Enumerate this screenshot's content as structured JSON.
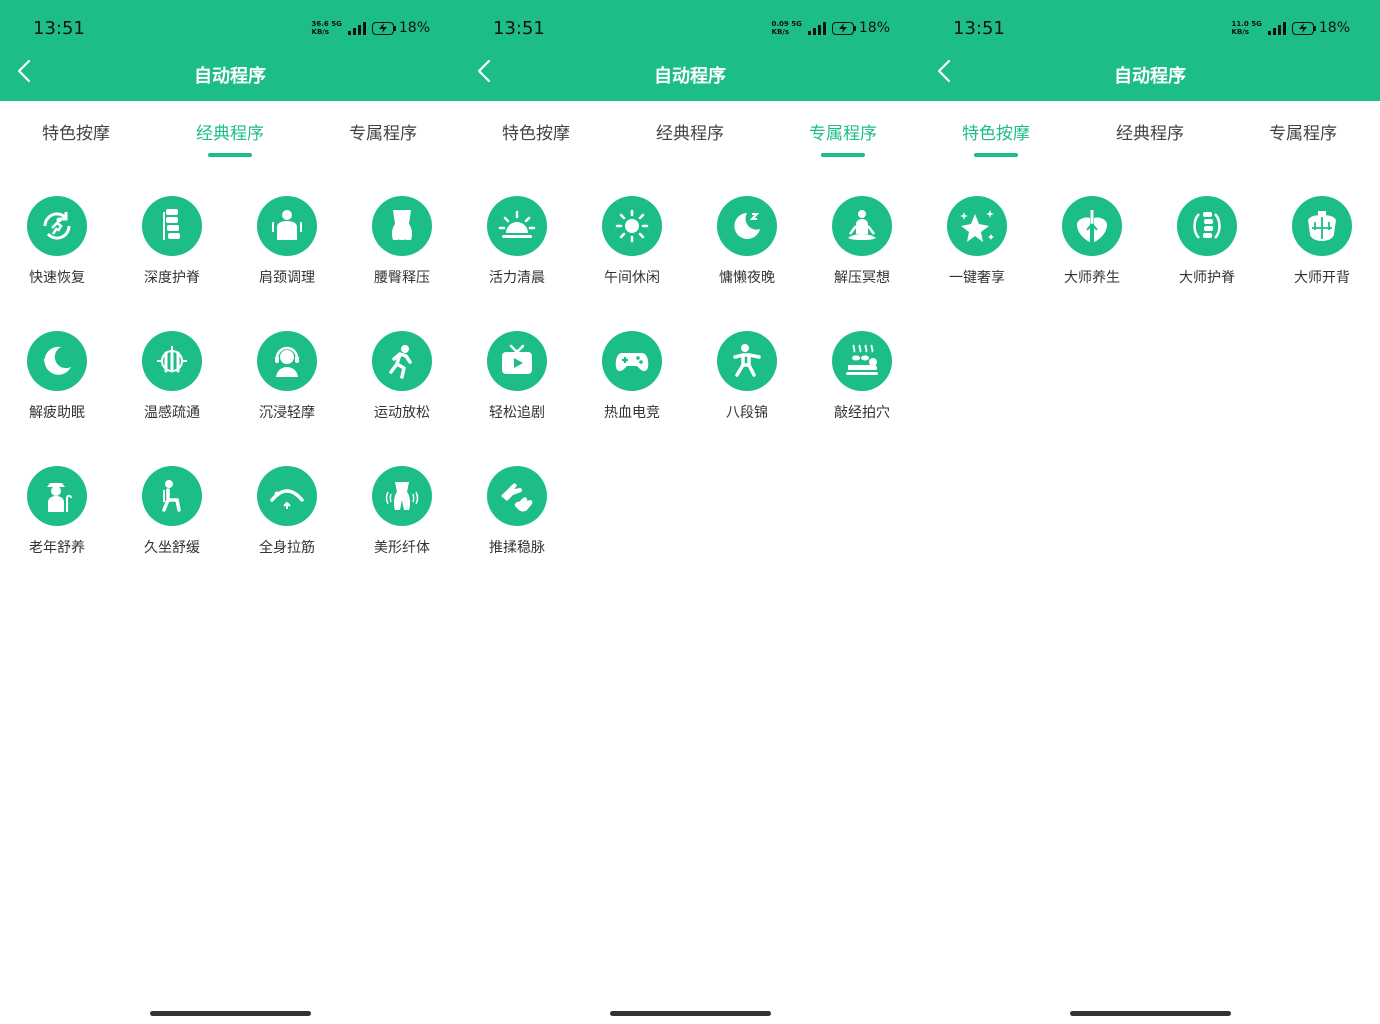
{
  "colors": {
    "accent": "#1dbd88",
    "text": "#333333"
  },
  "screens": [
    {
      "status": {
        "time": "13:51",
        "speed_top": "36.6",
        "speed_unit": "KB/s",
        "network": "5G",
        "battery": "18%"
      },
      "title": "自动程序",
      "tabs": [
        {
          "label": "特色按摩",
          "active": false
        },
        {
          "label": "经典程序",
          "active": true
        },
        {
          "label": "专属程序",
          "active": false
        }
      ],
      "items": [
        {
          "label": "快速恢复",
          "icon": "quick-recovery-icon"
        },
        {
          "label": "深度护脊",
          "icon": "spine-icon"
        },
        {
          "label": "肩颈调理",
          "icon": "shoulder-neck-icon"
        },
        {
          "label": "腰臀释压",
          "icon": "waist-hip-icon"
        },
        {
          "label": "解疲助眠",
          "icon": "moon-stars-icon"
        },
        {
          "label": "温感疏通",
          "icon": "warm-heat-icon"
        },
        {
          "label": "沉浸轻摩",
          "icon": "headphones-person-icon"
        },
        {
          "label": "运动放松",
          "icon": "running-icon"
        },
        {
          "label": "老年舒养",
          "icon": "elderly-icon"
        },
        {
          "label": "久坐舒缓",
          "icon": "sitting-icon"
        },
        {
          "label": "全身拉筋",
          "icon": "stretch-icon"
        },
        {
          "label": "美形纤体",
          "icon": "body-shape-icon"
        }
      ]
    },
    {
      "status": {
        "time": "13:51",
        "speed_top": "0.09",
        "speed_unit": "KB/s",
        "network": "5G",
        "battery": "18%"
      },
      "title": "自动程序",
      "tabs": [
        {
          "label": "特色按摩",
          "active": false
        },
        {
          "label": "经典程序",
          "active": false
        },
        {
          "label": "专属程序",
          "active": true
        }
      ],
      "items": [
        {
          "label": "活力清晨",
          "icon": "sunrise-icon"
        },
        {
          "label": "午间休闲",
          "icon": "sun-icon"
        },
        {
          "label": "慵懒夜晚",
          "icon": "moon-zz-icon"
        },
        {
          "label": "解压冥想",
          "icon": "meditation-icon"
        },
        {
          "label": "轻松追剧",
          "icon": "tv-icon"
        },
        {
          "label": "热血电竞",
          "icon": "gamepad-icon"
        },
        {
          "label": "八段锦",
          "icon": "tai-chi-icon"
        },
        {
          "label": "敲经拍穴",
          "icon": "hot-stone-icon"
        },
        {
          "label": "推揉稳脉",
          "icon": "hand-massage-icon"
        }
      ]
    },
    {
      "status": {
        "time": "13:51",
        "speed_top": "11.0",
        "speed_unit": "KB/s",
        "network": "5G",
        "battery": "18%"
      },
      "title": "自动程序",
      "tabs": [
        {
          "label": "特色按摩",
          "active": true
        },
        {
          "label": "经典程序",
          "active": false
        },
        {
          "label": "专属程序",
          "active": false
        }
      ],
      "items": [
        {
          "label": "一键奢享",
          "icon": "sparkle-stars-icon"
        },
        {
          "label": "大师养生",
          "icon": "lungs-icon"
        },
        {
          "label": "大师护脊",
          "icon": "spine-ring-icon"
        },
        {
          "label": "大师开背",
          "icon": "back-muscle-icon"
        }
      ]
    }
  ]
}
